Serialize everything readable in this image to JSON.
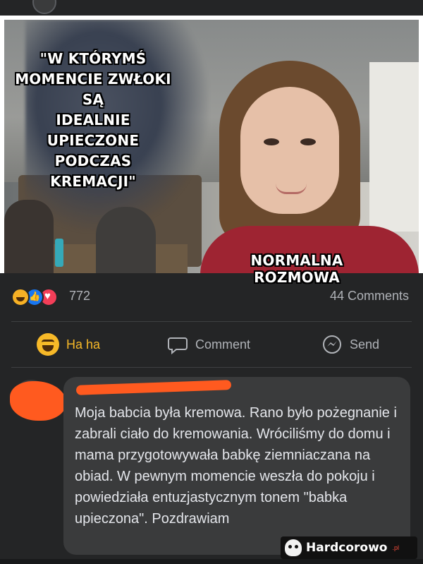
{
  "meme": {
    "caption_top_lines": [
      "\"W KTÓRYMŚ",
      "MOMENCIE ZWŁOKI SĄ",
      "IDEALNIE UPIECZONE",
      "PODCZAS KREMACJI\""
    ],
    "caption_bottom": "NORMALNA ROZMOWA"
  },
  "reactions": {
    "icons": [
      "haha-icon",
      "like-icon",
      "love-icon"
    ],
    "count": "772",
    "comments": "44 Comments"
  },
  "actions": {
    "haha": "Ha ha",
    "comment": "Comment",
    "send": "Send"
  },
  "comment": {
    "text": "Moja babcia była kremowa. Rano było pożegnanie i zabrali ciało do kremowania. Wróciliśmy do domu i mama przygotowywała babkę ziemniaczana na obiad. W pewnym momencie weszła do pokoju i powiedziała entuzjastycznym tonem \"babka upieczona\". Pozdrawiam"
  },
  "watermark": {
    "text": "Hardcorowo",
    "suffix": ".pl"
  },
  "colors": {
    "background": "#242526",
    "haha_accent": "#f7b928",
    "bubble": "#3a3b3c",
    "redaction": "#ff5a1f"
  }
}
